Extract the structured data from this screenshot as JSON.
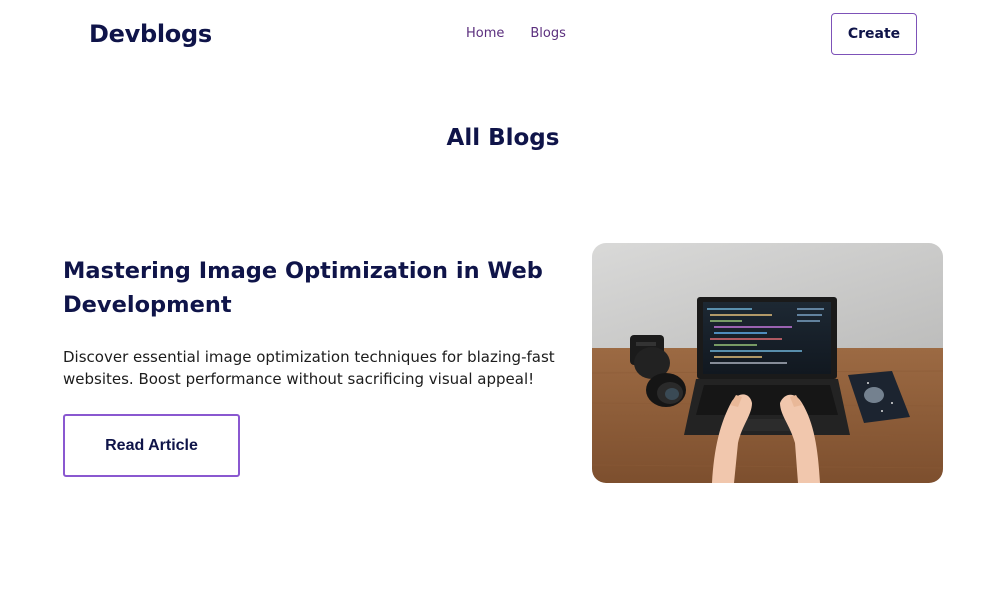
{
  "header": {
    "brand": "Devblogs",
    "nav": [
      {
        "label": "Home"
      },
      {
        "label": "Blogs"
      }
    ],
    "create_label": "Create"
  },
  "main": {
    "title": "All Blogs",
    "articles": [
      {
        "title": "Mastering Image Optimization in Web Development",
        "description": "Discover essential image optimization techniques for blazing-fast websites. Boost performance without sacrificing visual appeal!",
        "button_label": "Read Article",
        "image": "laptop-coding-photo"
      }
    ]
  },
  "colors": {
    "primary_text": "#0f1449",
    "nav_link": "#5b2f7e",
    "button_border": "#8a58d0",
    "create_border": "#7d52b8"
  }
}
